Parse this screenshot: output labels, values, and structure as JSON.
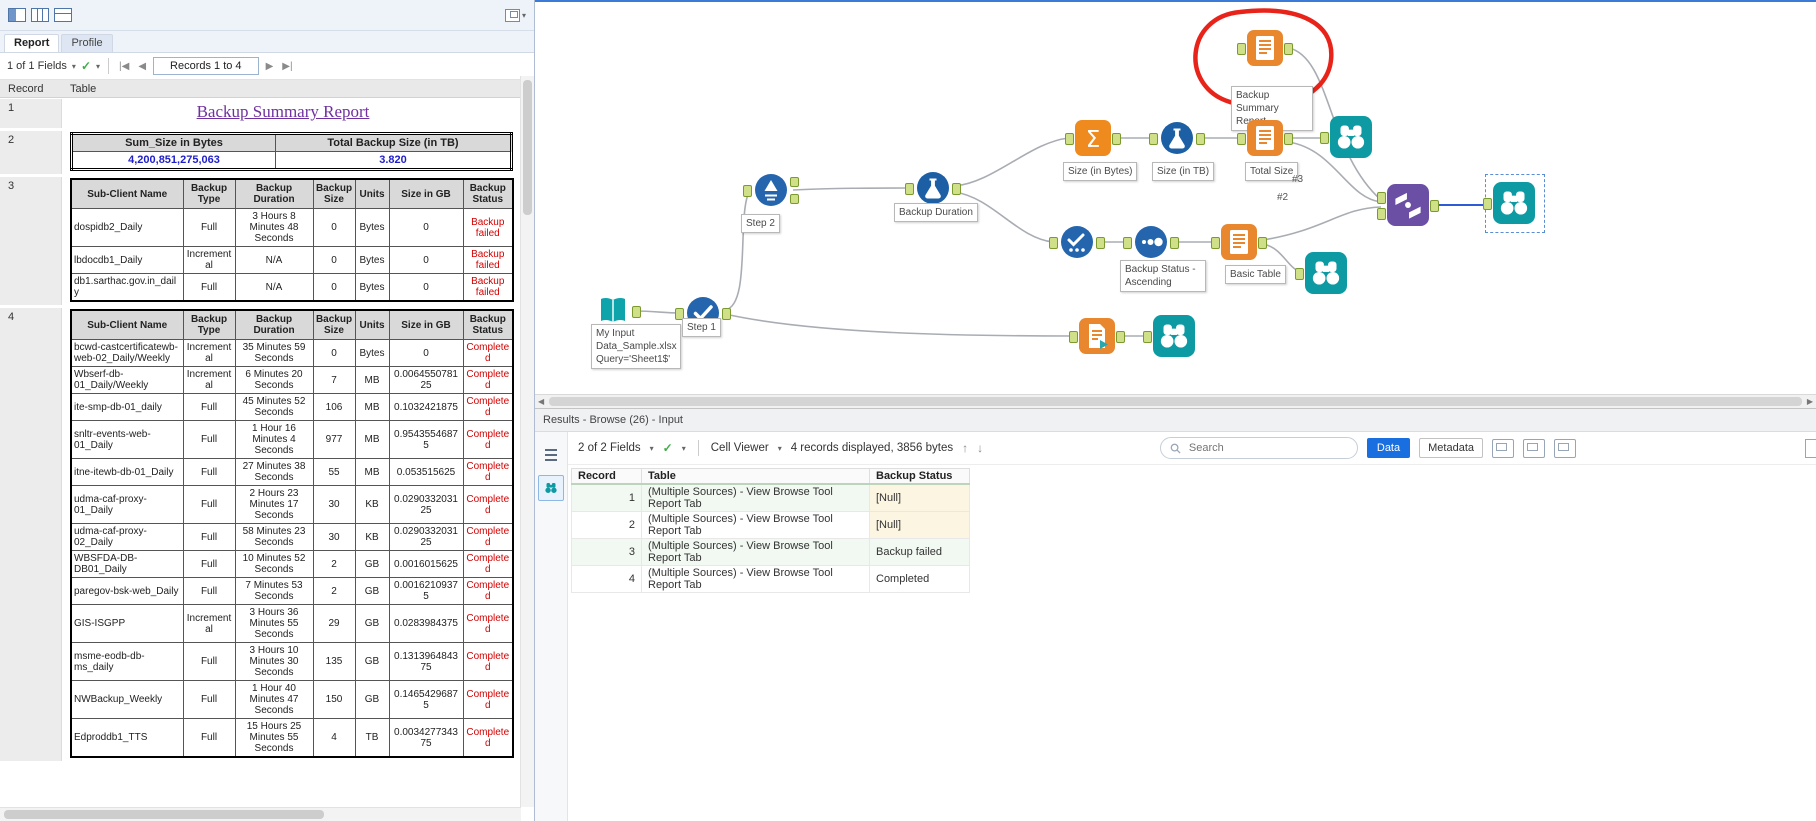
{
  "left_panel": {
    "tabs": [
      {
        "label": "Report"
      },
      {
        "label": "Profile"
      }
    ],
    "nav": {
      "fields_label": "1 of 1 Fields",
      "records_label": "Records 1 to 4"
    },
    "grid_headers": {
      "record": "Record",
      "table": "Table"
    },
    "records": {
      "r1": {
        "num": "1",
        "title": "Backup Summary Report"
      },
      "r2": {
        "num": "2",
        "headers": [
          "Sum_Size in Bytes",
          "Total Backup Size (in TB)"
        ],
        "values": [
          "4,200,851,275,063",
          "3.820"
        ]
      },
      "r3": {
        "num": "3",
        "headers": [
          "Sub-Client Name",
          "Backup Type",
          "Backup Duration",
          "Backup Size",
          "Units",
          "Size in GB",
          "Backup Status"
        ],
        "rows": [
          [
            "dospidb2_Daily",
            "Full",
            "3 Hours 8 Minutes 48 Seconds",
            "0",
            "Bytes",
            "0",
            "Backup failed"
          ],
          [
            "lbdocdb1_Daily",
            "Incremental",
            "N/A",
            "0",
            "Bytes",
            "0",
            "Backup failed"
          ],
          [
            "db1.sarthac.gov.in_daily",
            "Full",
            "N/A",
            "0",
            "Bytes",
            "0",
            "Backup failed"
          ]
        ]
      },
      "r4": {
        "num": "4",
        "headers": [
          "Sub-Client Name",
          "Backup Type",
          "Backup Duration",
          "Backup Size",
          "Units",
          "Size in GB",
          "Backup Status"
        ],
        "rows": [
          [
            "bcwd-castcertificatewb-web-02_Daily/Weekly",
            "Incremental",
            "35 Minutes 59 Seconds",
            "0",
            "Bytes",
            "0",
            "Completed"
          ],
          [
            "Wbserf-db-01_Daily/Weekly",
            "Incremental",
            "6 Minutes 20 Seconds",
            "7",
            "MB",
            "0.006455078125",
            "Completed"
          ],
          [
            "ite-smp-db-01_daily",
            "Full",
            "45 Minutes 52 Seconds",
            "106",
            "MB",
            "0.1032421875",
            "Completed"
          ],
          [
            "snltr-events-web-01_Daily",
            "Full",
            "1 Hour 16 Minutes 4 Seconds",
            "977",
            "MB",
            "0.95435546875",
            "Completed"
          ],
          [
            "itne-itewb-db-01_Daily",
            "Full",
            "27 Minutes 38 Seconds",
            "55",
            "MB",
            "0.053515625",
            "Completed"
          ],
          [
            "udma-caf-proxy-01_Daily",
            "Full",
            "2 Hours 23 Minutes 17 Seconds",
            "30",
            "KB",
            "0.029033203125",
            "Completed"
          ],
          [
            "udma-caf-proxy-02_Daily",
            "Full",
            "58 Minutes 23 Seconds",
            "30",
            "KB",
            "0.029033203125",
            "Completed"
          ],
          [
            "WBSFDA-DB-DB01_Daily",
            "Full",
            "10 Minutes 52 Seconds",
            "2",
            "GB",
            "0.0016015625",
            "Completed"
          ],
          [
            "paregov-bsk-web_Daily",
            "Full",
            "7 Minutes 53 Seconds",
            "2",
            "GB",
            "0.00162109375",
            "Completed"
          ],
          [
            "GIS-ISGPP",
            "Incremental",
            "3 Hours 36 Minutes 55 Seconds",
            "29",
            "GB",
            "0.0283984375",
            "Completed"
          ],
          [
            "msme-eodb-db-ms_daily",
            "Full",
            "3 Hours 10 Minutes 30 Seconds",
            "135",
            "GB",
            "0.131396484375",
            "Completed"
          ],
          [
            "NWBackup_Weekly",
            "Full",
            "1 Hour 40 Minutes 47 Seconds",
            "150",
            "GB",
            "0.14654296875",
            "Completed"
          ],
          [
            "Edproddb1_TTS",
            "Full",
            "15 Hours 25 Minutes 55 Seconds",
            "4",
            "TB",
            "0.003427734375",
            "Completed"
          ]
        ]
      }
    }
  },
  "canvas": {
    "tools": {
      "input": {
        "label": "My Input\nData_Sample.xlsx\nQuery='Sheet1$'"
      },
      "step1": {
        "label": "Step 1"
      },
      "step2": {
        "label": "Step 2"
      },
      "backup_duration": {
        "label": "Backup Duration"
      },
      "size_bytes": {
        "label": "Size (in Bytes)"
      },
      "size_tb": {
        "label": "Size (in TB)"
      },
      "total_size": {
        "label": "Total Size"
      },
      "status_asc": {
        "label": "Backup Status -\nAscending"
      },
      "basic_table": {
        "label": "Basic Table"
      },
      "summary_report": {
        "label": "Backup Summary\nReport"
      }
    },
    "connection_labels": {
      "c2": "#2",
      "c3": "#3"
    }
  },
  "results_panel": {
    "title": "Results - Browse (26) - Input",
    "toolbar": {
      "fields": "2 of 2 Fields",
      "cell_viewer": "Cell Viewer",
      "records_info": "4 records displayed, 3856 bytes",
      "search_placeholder": "Search",
      "data_button": "Data",
      "metadata_button": "Metadata",
      "icons": [
        "copy-icon",
        "save-icon",
        "new-window-icon"
      ]
    },
    "grid": {
      "headers": [
        "Record",
        "Table",
        "Backup Status"
      ],
      "rows": [
        [
          "1",
          "(Multiple Sources) - View Browse Tool Report Tab",
          "[Null]"
        ],
        [
          "2",
          "(Multiple Sources) - View Browse Tool Report Tab",
          "[Null]"
        ],
        [
          "3",
          "(Multiple Sources) - View Browse Tool Report Tab",
          "Backup failed"
        ],
        [
          "4",
          "(Multiple Sources) - View Browse Tool Report Tab",
          "Completed"
        ]
      ]
    }
  },
  "colors": {
    "report_title_purple": "#7030a0",
    "report_value_blue": "#1f1fc8",
    "status_red": "#d40000",
    "data_button_blue": "#1a6fe0",
    "tool_orange": "#e8872e",
    "tool_teal": "#0d9aa2",
    "tool_blue": "#2565ae",
    "tool_purple": "#6a4fa5",
    "annotation_red": "#e8241a",
    "link_blue": "#2356c5"
  }
}
